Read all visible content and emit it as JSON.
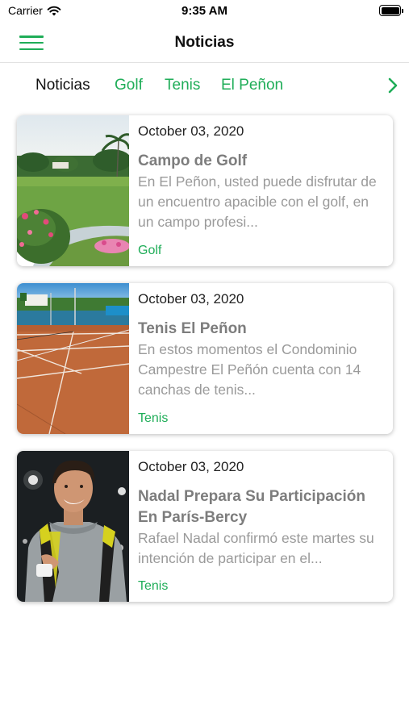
{
  "status_bar": {
    "carrier": "Carrier",
    "time": "9:35 AM",
    "wifi_icon": "wifi-icon",
    "battery_icon": "battery-icon"
  },
  "nav": {
    "title": "Noticias",
    "menu_icon": "hamburger-menu-icon"
  },
  "tabs": [
    {
      "label": "Noticias",
      "active": true
    },
    {
      "label": "Golf",
      "active": false
    },
    {
      "label": "Tenis",
      "active": false
    },
    {
      "label": "El Peñon",
      "active": false
    }
  ],
  "tabs_next_icon": "chevron-right-icon",
  "colors": {
    "accent": "#1fad58",
    "title_gray": "#7d7d7d",
    "excerpt_gray": "#9a9a9a"
  },
  "articles": [
    {
      "date": "October 03, 2020",
      "title": "Campo de Golf",
      "excerpt": "En El Peñon, usted puede disfrutar de un encuentro apacible con el golf, en un campo profesi...",
      "category": "Golf",
      "image": "golf-course-photo"
    },
    {
      "date": "October 03, 2020",
      "title": "Tenis El Peñon",
      "excerpt": "En estos momentos el Condominio Campestre El Peñón cuenta con 14 canchas de tenis...",
      "category": "Tenis",
      "image": "clay-tennis-court-photo"
    },
    {
      "date": "October 03, 2020",
      "title": "Nadal Prepara Su Participación En París-Bercy",
      "excerpt": "Rafael Nadal confirmó este martes su intención de participar en el...",
      "category": "Tenis",
      "image": "tennis-player-photo"
    }
  ]
}
